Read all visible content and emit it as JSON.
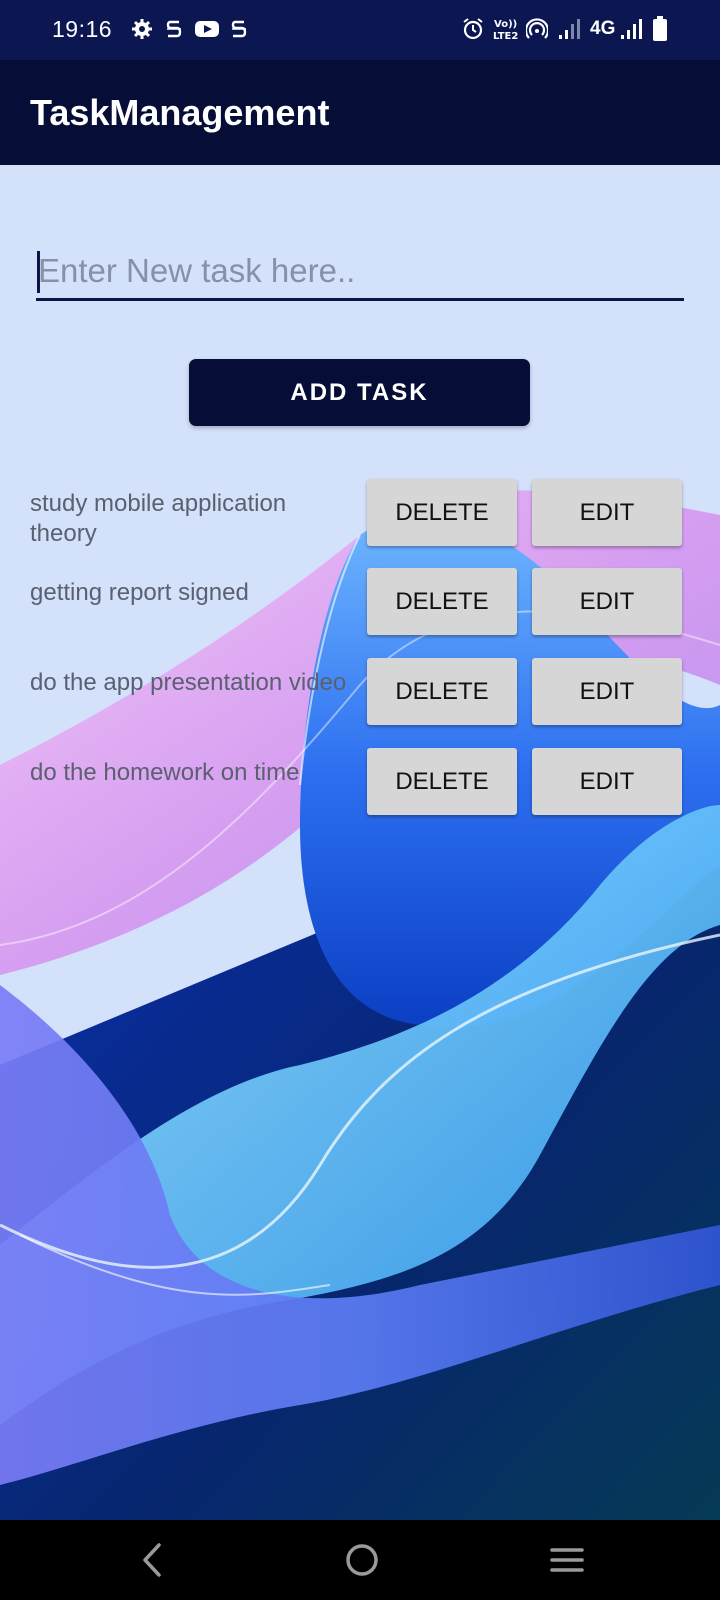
{
  "status_bar": {
    "time": "19:16",
    "network": "4G",
    "icons": [
      "gear-icon",
      "s-notification-icon",
      "youtube-icon",
      "s-notification-icon",
      "alarm-icon",
      "volte-icon",
      "hotspot-icon",
      "signal-icon",
      "signal-icon",
      "battery-icon"
    ]
  },
  "app_bar": {
    "title": "TaskManagement"
  },
  "task_input": {
    "placeholder": "Enter New task here..",
    "value": ""
  },
  "add_button": {
    "label": "ADD TASK"
  },
  "tasks": [
    {
      "text": "study mobile application theory",
      "delete_label": "DELETE",
      "edit_label": "EDIT"
    },
    {
      "text": "getting report signed",
      "delete_label": "DELETE",
      "edit_label": "EDIT"
    },
    {
      "text": "do the app presentation video",
      "delete_label": "DELETE",
      "edit_label": "EDIT"
    },
    {
      "text": "do the homework on time",
      "delete_label": "DELETE",
      "edit_label": "EDIT"
    }
  ],
  "nav_bar": {
    "icons": [
      "back-icon",
      "home-icon",
      "recents-icon"
    ]
  },
  "colors": {
    "status_bar": "#0c1650",
    "app_bar": "#060d36",
    "content_bg": "#d3e1fb",
    "button_gray": "#d6d6d6"
  }
}
